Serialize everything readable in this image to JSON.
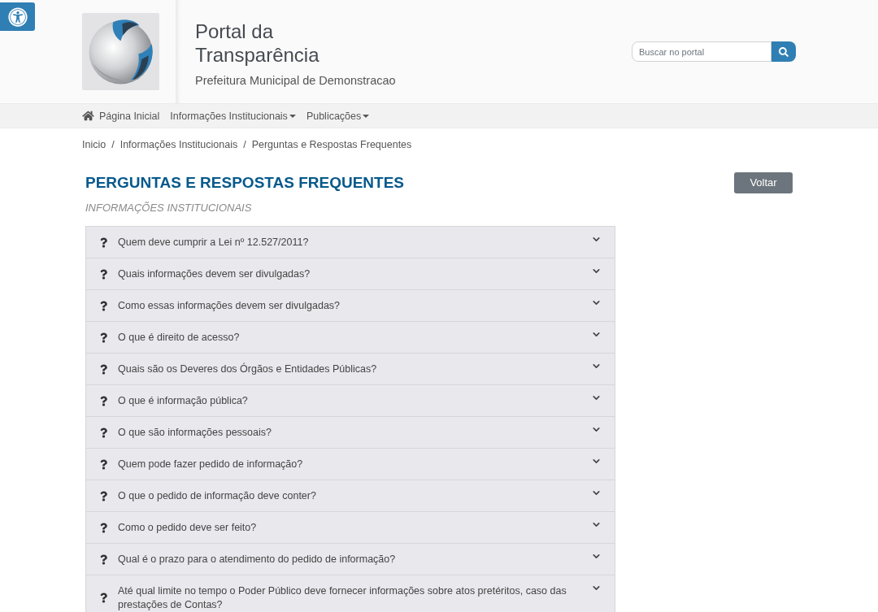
{
  "header": {
    "title": "Portal da Transparência",
    "subtitle": "Prefeitura Municipal de Demonstracao",
    "search": {
      "placeholder": "Buscar no portal"
    }
  },
  "nav": {
    "items": [
      {
        "label": "Página Inicial",
        "kind": "home"
      },
      {
        "label": "Informações Institucionais",
        "kind": "dropdown"
      },
      {
        "label": "Publicações",
        "kind": "dropdown"
      }
    ]
  },
  "breadcrumb": {
    "separator": "/",
    "items": [
      "Inicio",
      "Informações Institucionais",
      "Perguntas e Respostas Frequentes"
    ]
  },
  "page": {
    "title": "PERGUNTAS E RESPOSTAS FREQUENTES",
    "subtitle": "INFORMAÇÕES INSTITUCIONAIS",
    "back_button": "Voltar"
  },
  "faq": [
    {
      "question": "Quem deve cumprir a Lei nº 12.527/2011?",
      "expanded": false
    },
    {
      "question": "Quais informações devem ser divulgadas?",
      "expanded": false
    },
    {
      "question": "Como essas informações devem ser divulgadas?",
      "expanded": false
    },
    {
      "question": "O que é direito de acesso?",
      "expanded": false
    },
    {
      "question": "Quais são os Deveres dos Órgãos e Entidades Públicas?",
      "expanded": false
    },
    {
      "question": "O que é informação pública?",
      "expanded": false
    },
    {
      "question": "O que são informações pessoais?",
      "expanded": false
    },
    {
      "question": "Quem pode fazer pedido de informação?",
      "expanded": false
    },
    {
      "question": "O que o pedido de informação deve conter?",
      "expanded": false
    },
    {
      "question": "Como o pedido deve ser feito?",
      "expanded": false
    },
    {
      "question": "Qual é o prazo para o atendimento do pedido de informação?",
      "expanded": false
    },
    {
      "question": "Até qual limite no tempo o Poder Público deve fornecer informações sobre atos pretéritos, caso das prestações de Contas?",
      "expanded": false
    }
  ]
}
